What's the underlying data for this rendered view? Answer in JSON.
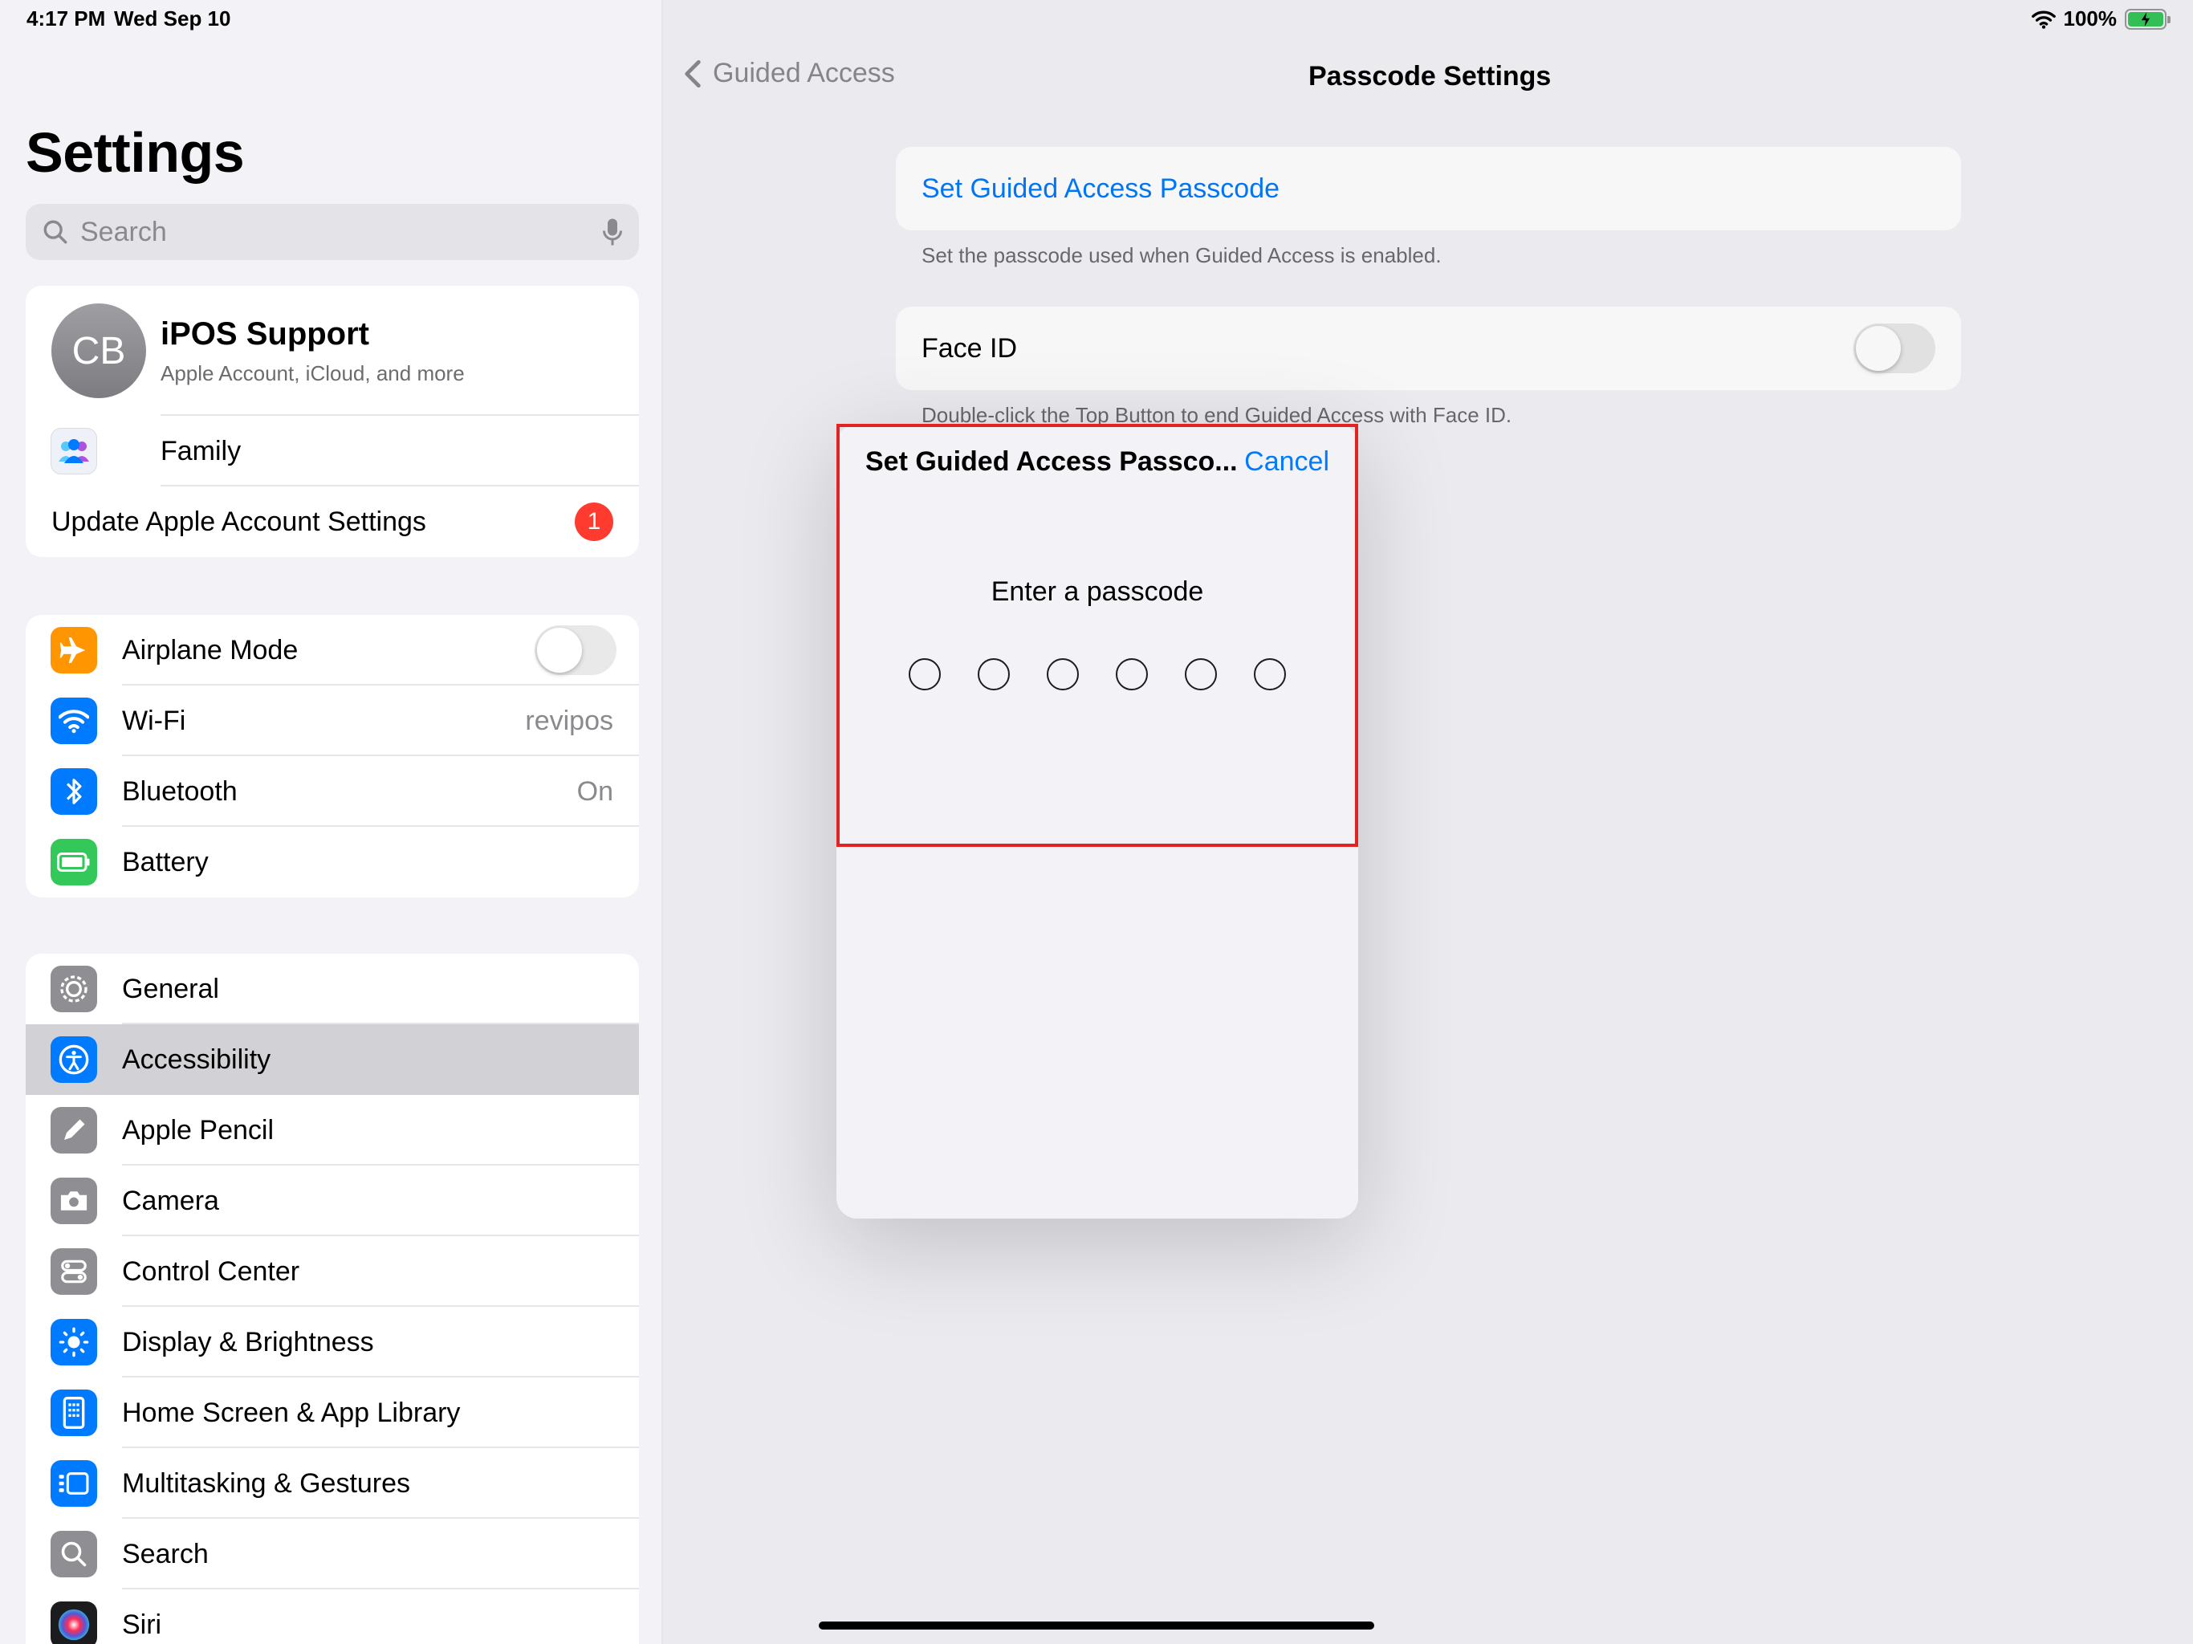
{
  "status": {
    "time": "4:17 PM",
    "date": "Wed Sep 10",
    "battery": "100%"
  },
  "sidebar": {
    "title": "Settings",
    "search_placeholder": "Search",
    "account": {
      "initials": "CB",
      "name": "iPOS Support",
      "subtitle": "Apple Account, iCloud, and more",
      "family_label": "Family",
      "update_label": "Update Apple Account Settings",
      "update_badge": "1"
    },
    "connectivity": [
      {
        "label": "Airplane Mode",
        "value": "",
        "icon": "airplane-icon",
        "color": "#ff9500"
      },
      {
        "label": "Wi-Fi",
        "value": "revipos",
        "icon": "wifi-icon",
        "color": "#007aff"
      },
      {
        "label": "Bluetooth",
        "value": "On",
        "icon": "bluetooth-icon",
        "color": "#007aff"
      },
      {
        "label": "Battery",
        "value": "",
        "icon": "battery-icon",
        "color": "#34c759"
      }
    ],
    "general": [
      {
        "label": "General",
        "icon": "gear-icon",
        "color": "#8e8e93"
      },
      {
        "label": "Accessibility",
        "icon": "accessibility-icon",
        "color": "#007aff"
      },
      {
        "label": "Apple Pencil",
        "icon": "pencil-icon",
        "color": "#8e8e93"
      },
      {
        "label": "Camera",
        "icon": "camera-icon",
        "color": "#8e8e93"
      },
      {
        "label": "Control Center",
        "icon": "control-center-icon",
        "color": "#8e8e93"
      },
      {
        "label": "Display & Brightness",
        "icon": "sun-icon",
        "color": "#007aff"
      },
      {
        "label": "Home Screen & App Library",
        "icon": "home-screen-icon",
        "color": "#007aff"
      },
      {
        "label": "Multitasking & Gestures",
        "icon": "multitasking-icon",
        "color": "#007aff"
      },
      {
        "label": "Search",
        "icon": "search-icon",
        "color": "#8e8e93"
      },
      {
        "label": "Siri",
        "icon": "siri-icon",
        "color": "#222222"
      }
    ]
  },
  "detail": {
    "back_label": "Guided Access",
    "title": "Passcode Settings",
    "set_passcode_label": "Set Guided Access Passcode",
    "set_passcode_footnote": "Set the passcode used when Guided Access is enabled.",
    "face_id_label": "Face ID",
    "face_id_footnote": "Double-click the Top Button to end Guided Access with Face ID."
  },
  "modal": {
    "title": "Set Guided Access Passco...",
    "cancel_label": "Cancel",
    "prompt": "Enter a passcode",
    "digit_count": 6
  },
  "colors": {
    "accent": "#007aff",
    "highlight_box": "#e02424",
    "badge": "#ff3b30"
  }
}
